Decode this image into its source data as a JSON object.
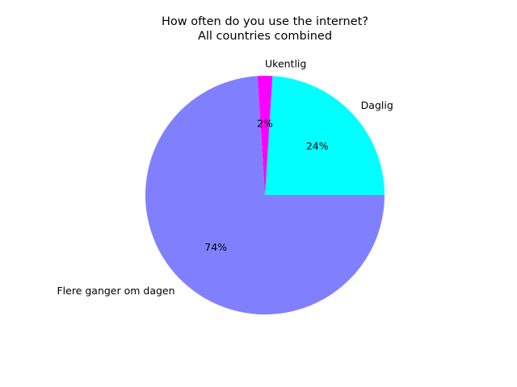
{
  "chart_data": {
    "type": "pie",
    "title": "How often do you use the internet?",
    "subtitle": "All countries combined",
    "categories": [
      "Daglig",
      "Ukentlig",
      "Flere ganger om dagen"
    ],
    "values": [
      24,
      2,
      74
    ],
    "autopct_labels": [
      "24%",
      "2%",
      "74%"
    ],
    "colors": [
      "#00ffff",
      "#ff00ff",
      "#8080ff"
    ],
    "start_angle_deg": 0,
    "direction": "counterclockwise",
    "legend": "none",
    "grid": false
  }
}
